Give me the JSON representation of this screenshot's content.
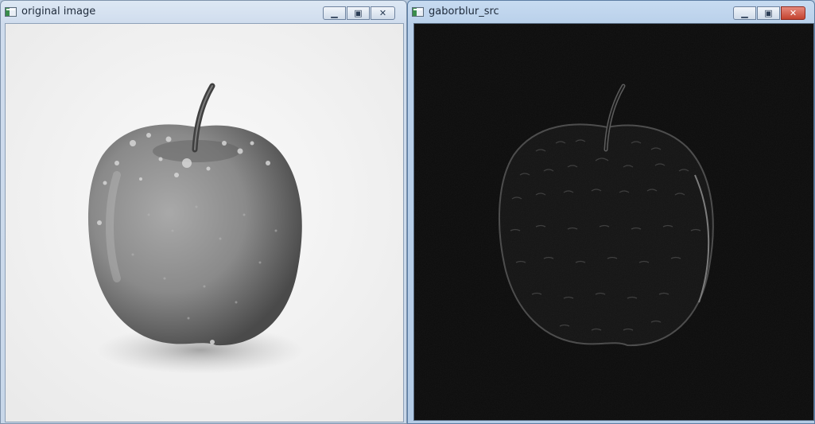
{
  "windows": [
    {
      "title": "original image",
      "controls": [
        "minimize-icon",
        "maximize-icon",
        "close-icon"
      ],
      "content": "apple-photo-grayscale"
    },
    {
      "title": "gaborblur_src",
      "controls": [
        "minimize-icon",
        "maximize-icon",
        "close-icon"
      ],
      "content": "apple-gabor-filtered"
    }
  ],
  "colors": {
    "titlebar": "#cfdced",
    "active_close": "#c3432f",
    "filtered_background": "#0c0c0c"
  }
}
